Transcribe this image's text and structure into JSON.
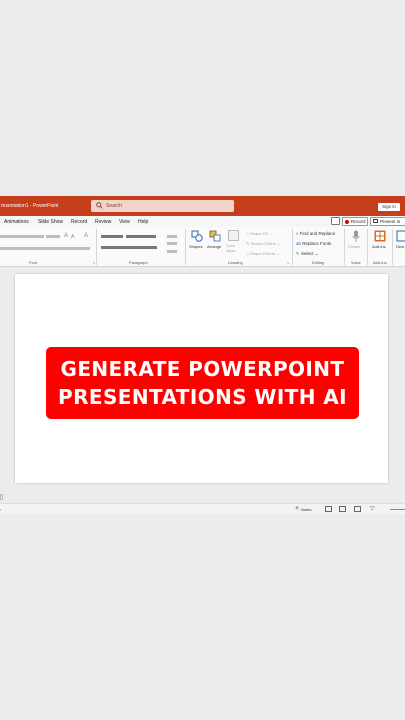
{
  "titlebar": {
    "title": "resentation1 - PowerPoint",
    "search_placeholder": "Search",
    "signin_label": "Sign in",
    "bg_color": "#c43e1c"
  },
  "tabs": [
    "Animations",
    "Slide Show",
    "Record",
    "Review",
    "View",
    "Help"
  ],
  "tab_buttons": {
    "record": "Record",
    "present": "Present in"
  },
  "ribbon": {
    "groups": {
      "font": "Font",
      "paragraph": "Paragraph",
      "drawing": "Drawing",
      "editing": "Editing",
      "voice": "Voice",
      "addins": "Add-ins"
    },
    "drawing": {
      "shapes": "Shapes",
      "arrange": "Arrange",
      "quick_styles": "Quick Styles",
      "shape_fill": "Shape Fill",
      "shape_outline": "Shape Outline",
      "shape_effects": "Shape Effects"
    },
    "editing": {
      "find_replace": "Find and Replace",
      "replace_fonts": "Replace Fonts",
      "select": "Select"
    },
    "voice": {
      "dictate": "Dictate"
    },
    "addins": {
      "add_ins": "Add-ins",
      "designer": "Desi"
    }
  },
  "slide": {
    "banner_lines": [
      "GENERATE POWERPOINT",
      "PRESENTATIONS WITH AI"
    ],
    "banner_color": "#ff0000"
  },
  "statusbar": {
    "notes_label": "Notes"
  }
}
